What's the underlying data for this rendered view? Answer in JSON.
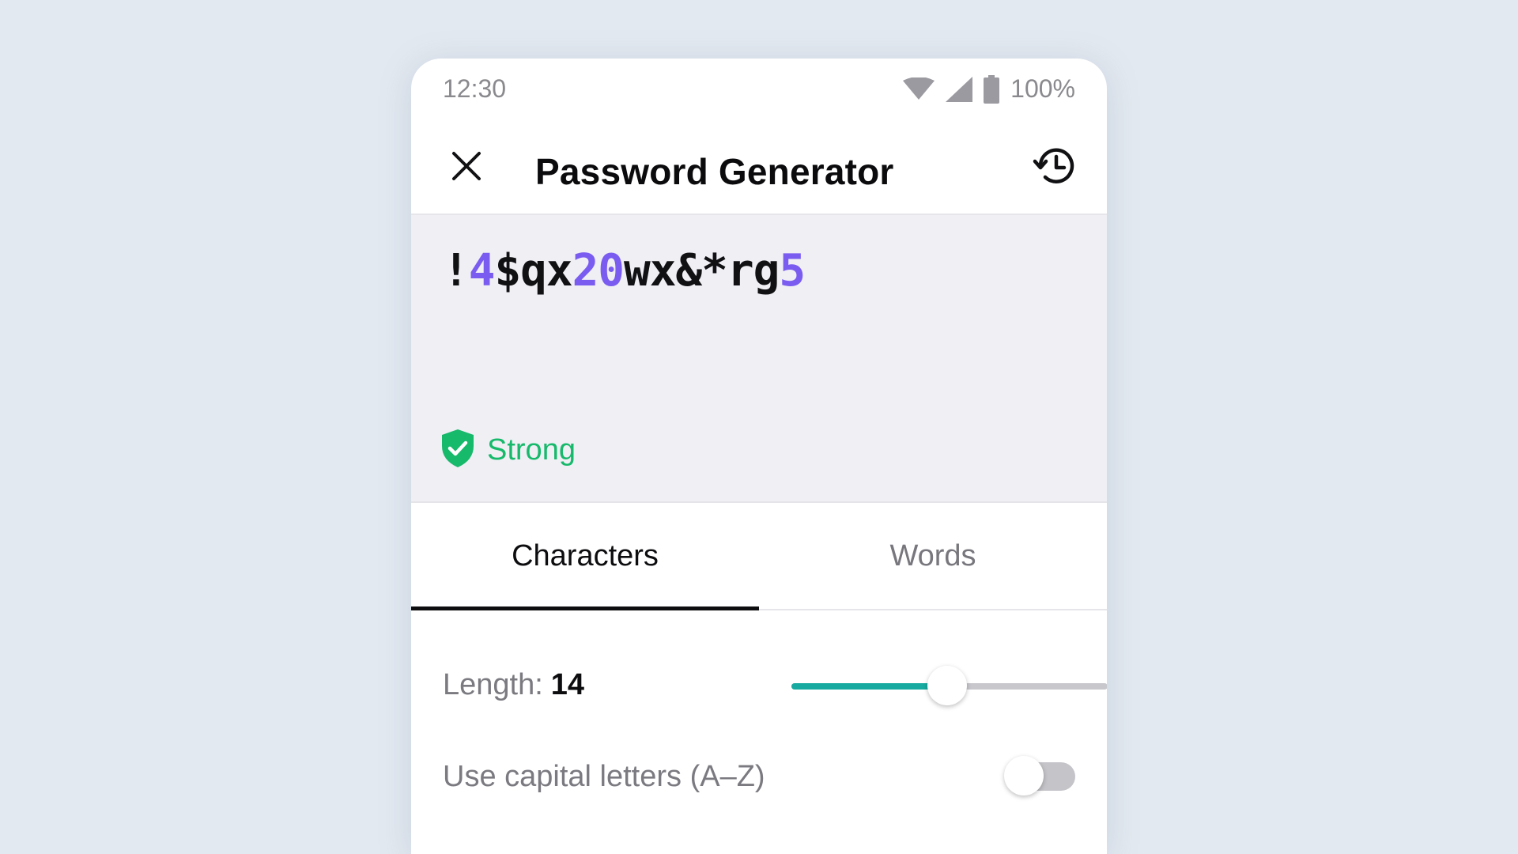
{
  "status_bar": {
    "time": "12:30",
    "battery": "100%",
    "icons": [
      "wifi-icon",
      "signal-icon",
      "battery-icon"
    ]
  },
  "app_bar": {
    "title": "Password Generator",
    "close_icon": "close-icon",
    "history_icon": "history-icon"
  },
  "password": {
    "segments": [
      {
        "text": "!",
        "kind": "symbol"
      },
      {
        "text": "4",
        "kind": "digit"
      },
      {
        "text": "$qx",
        "kind": "symbol"
      },
      {
        "text": "20",
        "kind": "digit"
      },
      {
        "text": "wx&*rg",
        "kind": "symbol"
      },
      {
        "text": "5",
        "kind": "digit"
      }
    ],
    "strength": "Strong",
    "strength_icon": "shield-check-icon"
  },
  "tabs": [
    {
      "label": "Characters",
      "active": true
    },
    {
      "label": "Words",
      "active": false
    }
  ],
  "options": {
    "length_label": "Length:",
    "length_value": "14",
    "capital_label": "Use capital letters (A–Z)",
    "capital_enabled": false
  },
  "colors": {
    "accent_digit": "#7a5cf0",
    "strong": "#17b96b",
    "slider": "#16aaa0",
    "background": "#e3e9f0"
  }
}
